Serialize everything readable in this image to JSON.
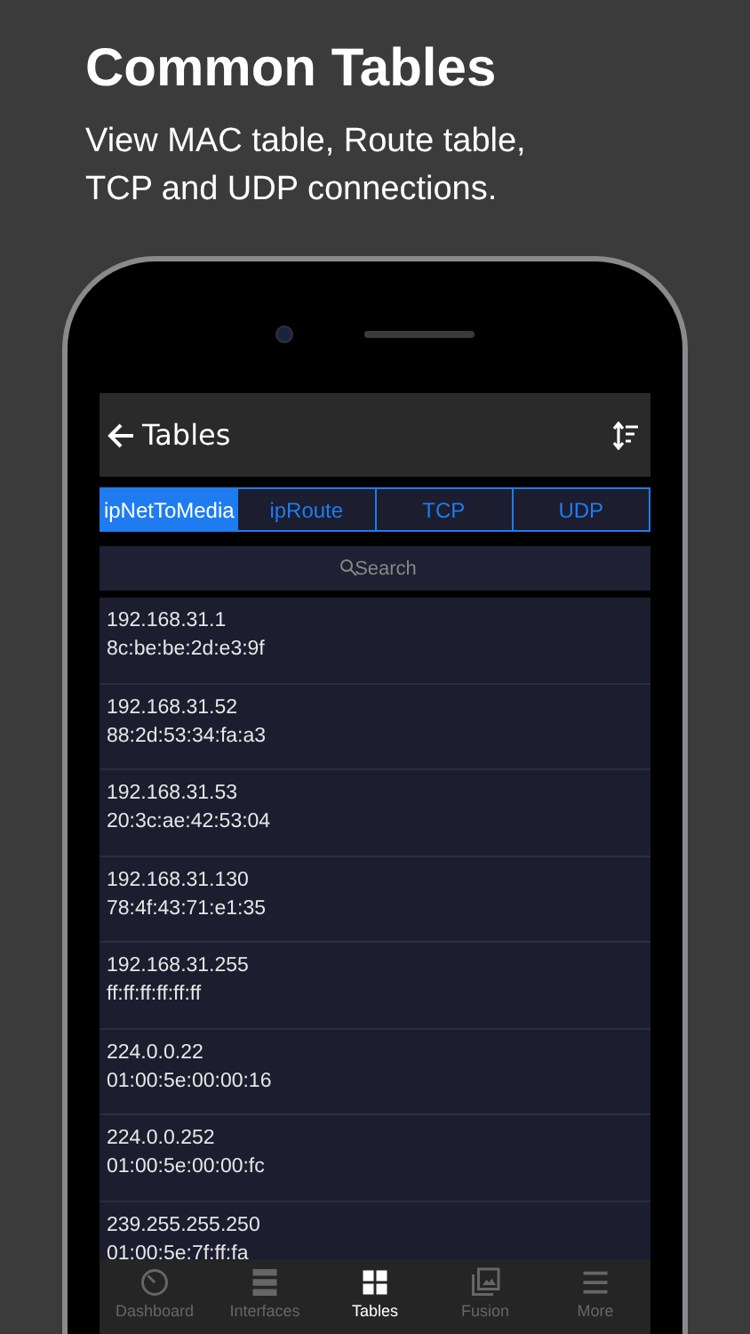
{
  "headline": {
    "title": "Common Tables",
    "subtitle": "View MAC table, Route table, TCP and UDP connections."
  },
  "toolbar": {
    "title": "Tables"
  },
  "tabs": [
    {
      "label": "ipNetToMedia",
      "selected": true
    },
    {
      "label": "ipRoute",
      "selected": false
    },
    {
      "label": "TCP",
      "selected": false
    },
    {
      "label": "UDP",
      "selected": false
    }
  ],
  "search": {
    "placeholder": "Search"
  },
  "rows": [
    {
      "ip": "192.168.31.1",
      "mac": "8c:be:be:2d:e3:9f"
    },
    {
      "ip": "192.168.31.52",
      "mac": "88:2d:53:34:fa:a3"
    },
    {
      "ip": "192.168.31.53",
      "mac": "20:3c:ae:42:53:04"
    },
    {
      "ip": "192.168.31.130",
      "mac": "78:4f:43:71:e1:35"
    },
    {
      "ip": "192.168.31.255",
      "mac": "ff:ff:ff:ff:ff:ff"
    },
    {
      "ip": "224.0.0.22",
      "mac": "01:00:5e:00:00:16"
    },
    {
      "ip": "224.0.0.252",
      "mac": "01:00:5e:00:00:fc"
    },
    {
      "ip": "239.255.255.250",
      "mac": "01:00:5e:7f:ff:fa"
    }
  ],
  "tab_bar": [
    {
      "kind": "dashboard",
      "label": "Dashboard",
      "selected": false
    },
    {
      "kind": "interfaces",
      "label": "Interfaces",
      "selected": false
    },
    {
      "kind": "tables",
      "label": "Tables",
      "selected": true
    },
    {
      "kind": "fusion",
      "label": "Fusion",
      "selected": false
    },
    {
      "kind": "more",
      "label": "More",
      "selected": false
    }
  ]
}
